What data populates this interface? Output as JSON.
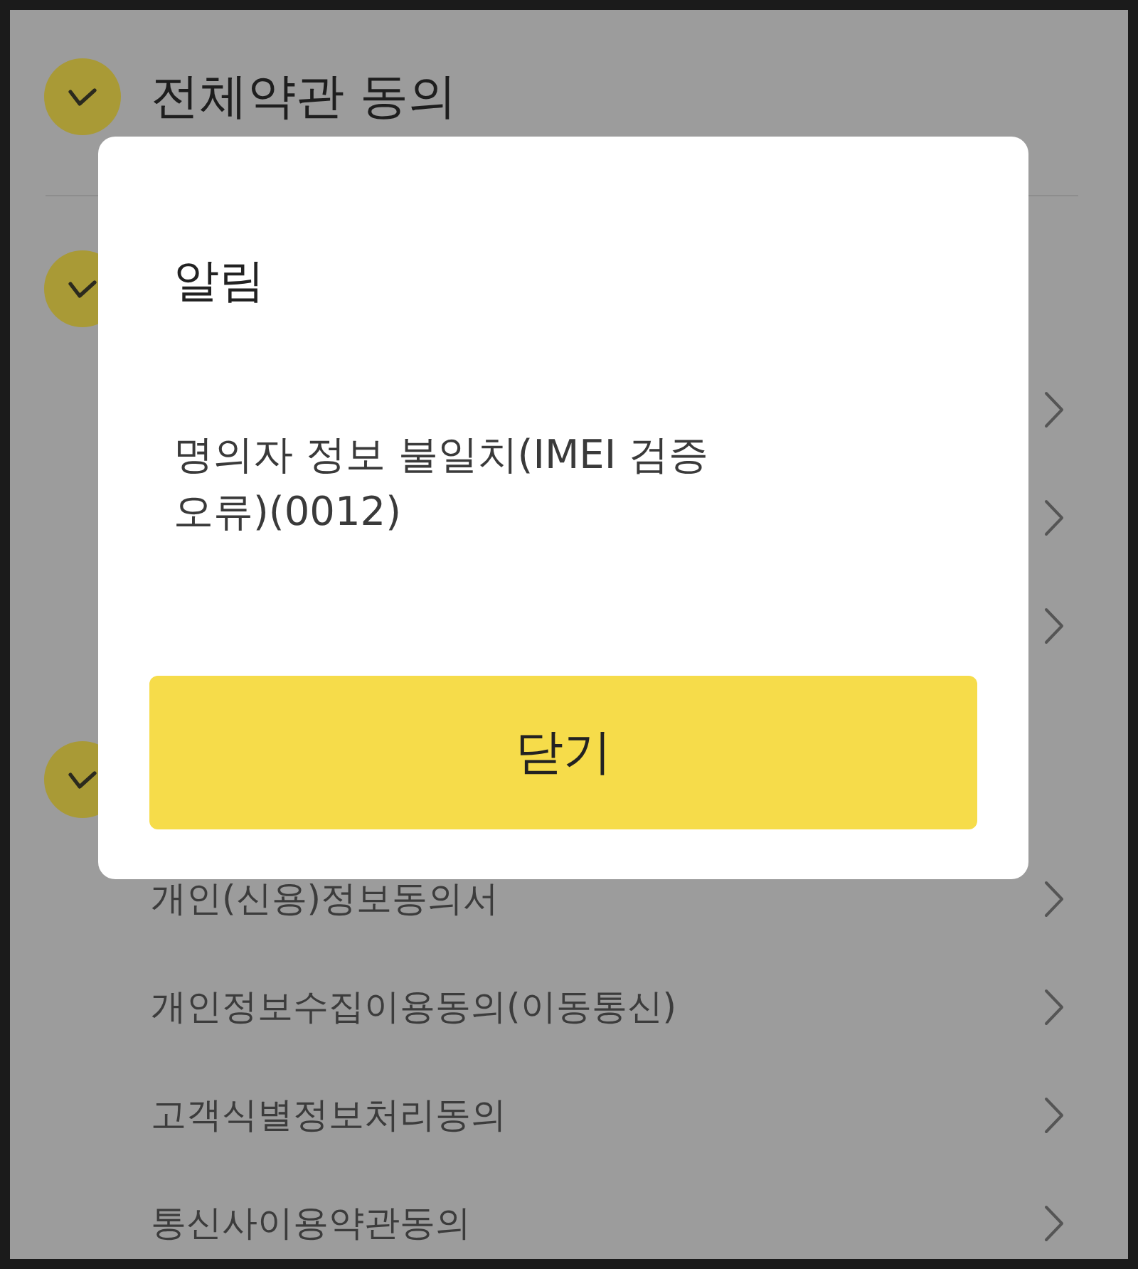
{
  "agreement": {
    "all": {
      "label": "전체약관 동의",
      "checked": true
    },
    "groups": [
      {
        "checked": true,
        "items": [
          {
            "kind": "covered"
          },
          {
            "kind": "covered"
          },
          {
            "kind": "covered"
          }
        ]
      },
      {
        "checked": true,
        "items": [
          {
            "kind": "term",
            "label": "개인(신용)정보동의서"
          },
          {
            "kind": "term",
            "label": "개인정보수집이용동의(이동통신)"
          },
          {
            "kind": "term",
            "label": "고객식별정보처리동의"
          },
          {
            "kind": "term",
            "label": "통신사이용약관동의"
          }
        ]
      }
    ]
  },
  "dialog": {
    "title": "알림",
    "message": "명의자 정보 불일치(IMEI 검증 오류)(0012)",
    "button": "닫기"
  }
}
